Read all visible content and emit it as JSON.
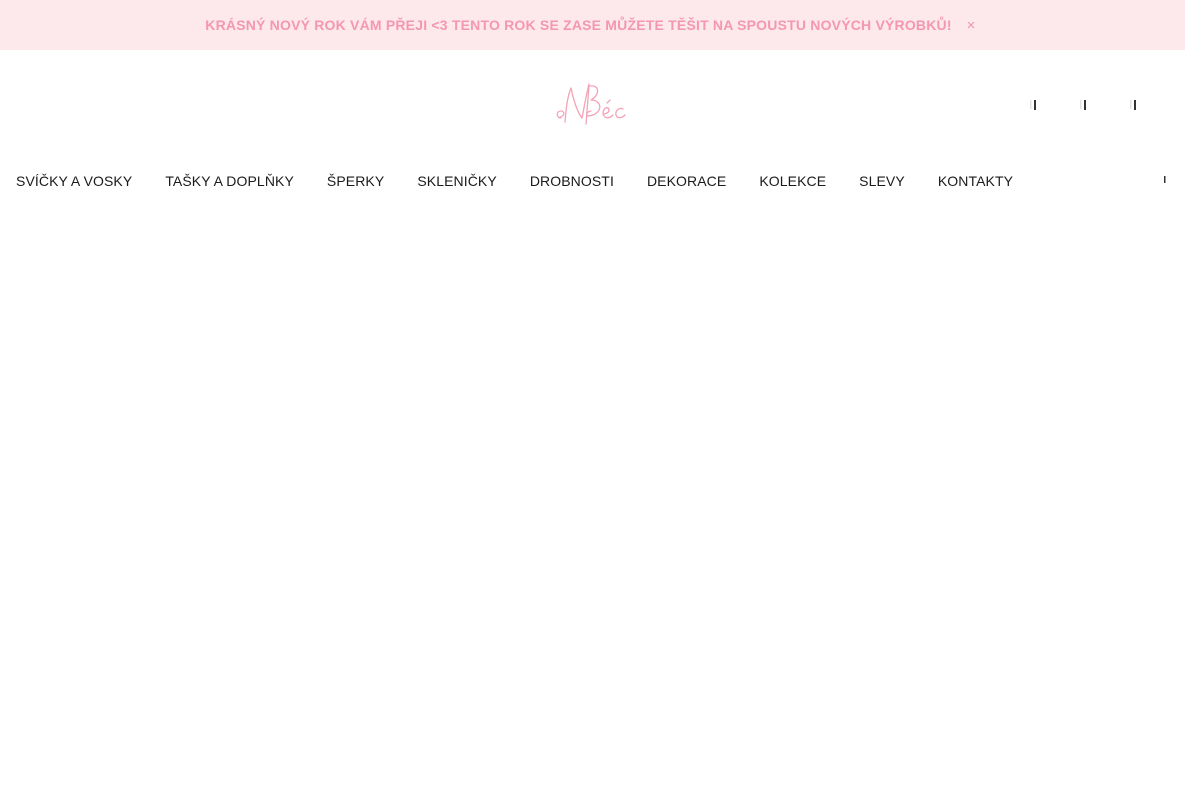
{
  "announcement": {
    "text": "KRÁSNÝ NOVÝ ROK VÁM PŘEJI <3 TENTO ROK SE ZASE MŮŽETE TĚŠIT NA SPOUSTU NOVÝCH VÝROBKŮ!",
    "close_icon": "close-icon",
    "text_color": "#f497b0",
    "background": "#fde8ec"
  },
  "header": {
    "logo_text": "NBéc",
    "logo_color": "#f497b0",
    "icons": [
      "search-icon",
      "user-icon",
      "cart-icon"
    ]
  },
  "nav": {
    "items": [
      {
        "label": "SVÍČKY A VOSKY"
      },
      {
        "label": "TAŠKY A DOPLŇKY"
      },
      {
        "label": "ŠPERKY"
      },
      {
        "label": "SKLENIČKY"
      },
      {
        "label": "DROBNOSTI"
      },
      {
        "label": "DEKORACE"
      },
      {
        "label": "KOLEKCE"
      },
      {
        "label": "SLEVY"
      },
      {
        "label": "KONTAKTY"
      }
    ],
    "more_icon": "chevron-icon"
  }
}
